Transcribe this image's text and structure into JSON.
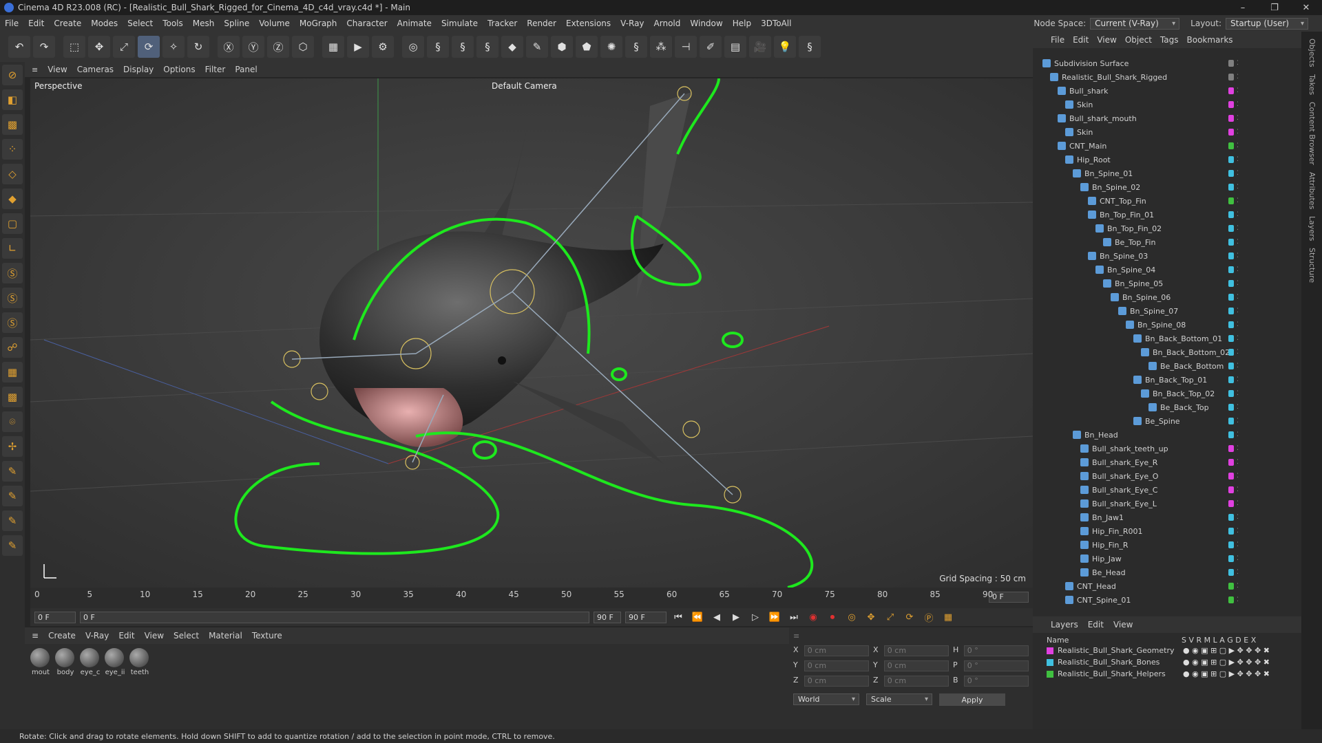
{
  "window": {
    "title": "Cinema 4D R23.008 (RC) - [Realistic_Bull_Shark_Rigged_for_Cinema_4D_c4d_vray.c4d *] - Main"
  },
  "menu": [
    "File",
    "Edit",
    "Create",
    "Modes",
    "Select",
    "Tools",
    "Mesh",
    "Spline",
    "Volume",
    "MoGraph",
    "Character",
    "Animate",
    "Simulate",
    "Tracker",
    "Render",
    "Extensions",
    "V-Ray",
    "Arnold",
    "Window",
    "Help",
    "3DToAll"
  ],
  "node_space": {
    "label": "Node Space:",
    "value": "Current (V-Ray)",
    "layout_label": "Layout:",
    "layout_value": "Startup (User)"
  },
  "viewport": {
    "menu": [
      "View",
      "Cameras",
      "Display",
      "Options",
      "Filter",
      "Panel"
    ],
    "label": "Perspective",
    "camera": "Default Camera",
    "grid_spacing": "Grid Spacing : 50 cm"
  },
  "timeline": {
    "ticks": [
      "0",
      "5",
      "10",
      "15",
      "20",
      "25",
      "30",
      "35",
      "40",
      "45",
      "50",
      "55",
      "60",
      "65",
      "70",
      "75",
      "80",
      "85",
      "90"
    ],
    "frame": "0 F"
  },
  "transport": {
    "start": "0 F",
    "current": "0 F",
    "end_a": "90 F",
    "end_b": "90 F"
  },
  "materials": {
    "menu": [
      "Create",
      "V-Ray",
      "Edit",
      "View",
      "Select",
      "Material",
      "Texture"
    ],
    "items": [
      "mout",
      "body",
      "eye_c",
      "eye_ii",
      "teeth"
    ]
  },
  "coords": {
    "rows": [
      {
        "a": "X",
        "v1": "0 cm",
        "b": "X",
        "v2": "0 cm",
        "c": "H",
        "v3": "0 °"
      },
      {
        "a": "Y",
        "v1": "0 cm",
        "b": "Y",
        "v2": "0 cm",
        "c": "P",
        "v3": "0 °"
      },
      {
        "a": "Z",
        "v1": "0 cm",
        "b": "Z",
        "v2": "0 cm",
        "c": "B",
        "v3": "0 °"
      }
    ],
    "world": "World",
    "scale": "Scale",
    "apply": "Apply"
  },
  "objects": {
    "menu": [
      "File",
      "Edit",
      "View",
      "Object",
      "Tags",
      "Bookmarks"
    ],
    "items": [
      {
        "name": "Subdivision Surface",
        "indent": 0,
        "color": "#808080"
      },
      {
        "name": "Realistic_Bull_Shark_Rigged",
        "indent": 1,
        "color": "#808080"
      },
      {
        "name": "Bull_shark",
        "indent": 2,
        "color": "#e040e0"
      },
      {
        "name": "Skin",
        "indent": 3,
        "color": "#e040e0"
      },
      {
        "name": "Bull_shark_mouth",
        "indent": 2,
        "color": "#e040e0"
      },
      {
        "name": "Skin",
        "indent": 3,
        "color": "#e040e0"
      },
      {
        "name": "CNT_Main",
        "indent": 2,
        "color": "#40c040"
      },
      {
        "name": "Hip_Root",
        "indent": 3,
        "color": "#40c0e0"
      },
      {
        "name": "Bn_Spine_01",
        "indent": 4,
        "color": "#40c0e0"
      },
      {
        "name": "Bn_Spine_02",
        "indent": 5,
        "color": "#40c0e0"
      },
      {
        "name": "CNT_Top_Fin",
        "indent": 6,
        "color": "#40c040"
      },
      {
        "name": "Bn_Top_Fin_01",
        "indent": 6,
        "color": "#40c0e0"
      },
      {
        "name": "Bn_Top_Fin_02",
        "indent": 7,
        "color": "#40c0e0"
      },
      {
        "name": "Be_Top_Fin",
        "indent": 8,
        "color": "#40c0e0"
      },
      {
        "name": "Bn_Spine_03",
        "indent": 6,
        "color": "#40c0e0"
      },
      {
        "name": "Bn_Spine_04",
        "indent": 7,
        "color": "#40c0e0"
      },
      {
        "name": "Bn_Spine_05",
        "indent": 8,
        "color": "#40c0e0"
      },
      {
        "name": "Bn_Spine_06",
        "indent": 9,
        "color": "#40c0e0"
      },
      {
        "name": "Bn_Spine_07",
        "indent": 10,
        "color": "#40c0e0"
      },
      {
        "name": "Bn_Spine_08",
        "indent": 11,
        "color": "#40c0e0"
      },
      {
        "name": "Bn_Back_Bottom_01",
        "indent": 12,
        "color": "#40c0e0"
      },
      {
        "name": "Bn_Back_Bottom_02",
        "indent": 13,
        "color": "#40c0e0"
      },
      {
        "name": "Be_Back_Bottom",
        "indent": 14,
        "color": "#40c0e0"
      },
      {
        "name": "Bn_Back_Top_01",
        "indent": 12,
        "color": "#40c0e0"
      },
      {
        "name": "Bn_Back_Top_02",
        "indent": 13,
        "color": "#40c0e0"
      },
      {
        "name": "Be_Back_Top",
        "indent": 14,
        "color": "#40c0e0"
      },
      {
        "name": "Be_Spine",
        "indent": 12,
        "color": "#40c0e0"
      },
      {
        "name": "Bn_Head",
        "indent": 4,
        "color": "#40c0e0"
      },
      {
        "name": "Bull_shark_teeth_up",
        "indent": 5,
        "color": "#e040e0"
      },
      {
        "name": "Bull_shark_Eye_R",
        "indent": 5,
        "color": "#e040e0"
      },
      {
        "name": "Bull_shark_Eye_O",
        "indent": 5,
        "color": "#e040e0"
      },
      {
        "name": "Bull_shark_Eye_C",
        "indent": 5,
        "color": "#e040e0"
      },
      {
        "name": "Bull_shark_Eye_L",
        "indent": 5,
        "color": "#e040e0"
      },
      {
        "name": "Bn_Jaw1",
        "indent": 5,
        "color": "#40c0e0"
      },
      {
        "name": "Hip_Fin_R001",
        "indent": 5,
        "color": "#40c0e0"
      },
      {
        "name": "Hip_Fin_R",
        "indent": 5,
        "color": "#40c0e0"
      },
      {
        "name": "Hip_Jaw",
        "indent": 5,
        "color": "#40c0e0"
      },
      {
        "name": "Be_Head",
        "indent": 5,
        "color": "#40c0e0"
      },
      {
        "name": "CNT_Head",
        "indent": 3,
        "color": "#40c040"
      },
      {
        "name": "CNT_Spine_01",
        "indent": 3,
        "color": "#40c040"
      }
    ]
  },
  "layers": {
    "menu": [
      "Layers",
      "Edit",
      "View"
    ],
    "header": {
      "name": "Name",
      "cols": "S V R M L A G D E X"
    },
    "items": [
      {
        "name": "Realistic_Bull_Shark_Geometry",
        "color": "#e040e0"
      },
      {
        "name": "Realistic_Bull_Shark_Bones",
        "color": "#40c0e0"
      },
      {
        "name": "Realistic_Bull_Shark_Helpers",
        "color": "#40c040"
      }
    ]
  },
  "side_tabs": [
    "Objects",
    "Takes",
    "Content Browser",
    "Attributes",
    "Layers",
    "Structure"
  ],
  "status": "Rotate: Click and drag to rotate elements. Hold down SHIFT to add to quantize rotation / add to the selection in point mode, CTRL to remove."
}
